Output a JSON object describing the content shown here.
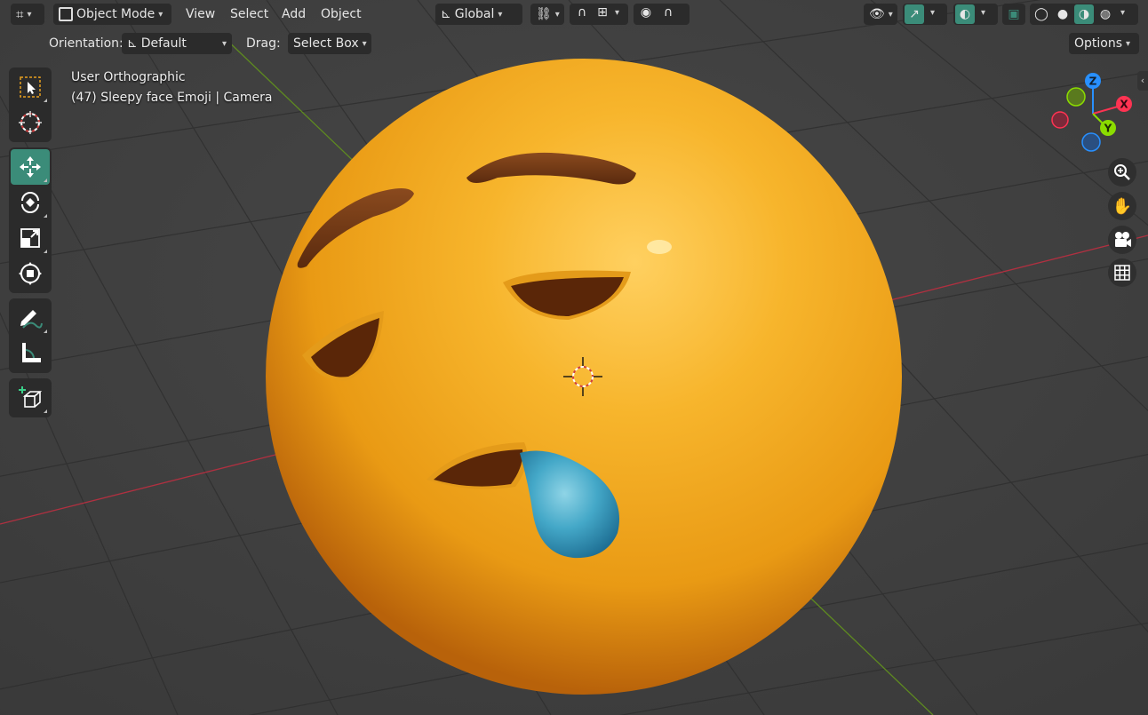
{
  "header": {
    "mode": "Object Mode",
    "menus": [
      "View",
      "Select",
      "Add",
      "Object"
    ],
    "transform_orientation": "Global"
  },
  "tool_settings": {
    "orientation_label": "Orientation:",
    "orientation_value": "Default",
    "drag_label": "Drag:",
    "drag_value": "Select Box",
    "options_label": "Options"
  },
  "viewport": {
    "view_name": "User Orthographic",
    "object_info": "(47) Sleepy face Emoji | Camera"
  },
  "gizmo": {
    "x": "X",
    "y": "Y",
    "z": "Z"
  },
  "toolbar": {
    "tools": [
      "select-box",
      "cursor",
      "move",
      "rotate",
      "scale",
      "transform",
      "annotate",
      "measure",
      "add-cube"
    ],
    "active": "move"
  },
  "colors": {
    "accent": "#3b8c79",
    "x_axis": "#ff3352",
    "y_axis": "#8bdc00",
    "z_axis": "#2890ff",
    "emoji_face": "#f0a81e",
    "drool": "#3aa2c4",
    "brows": "#6b3414"
  }
}
